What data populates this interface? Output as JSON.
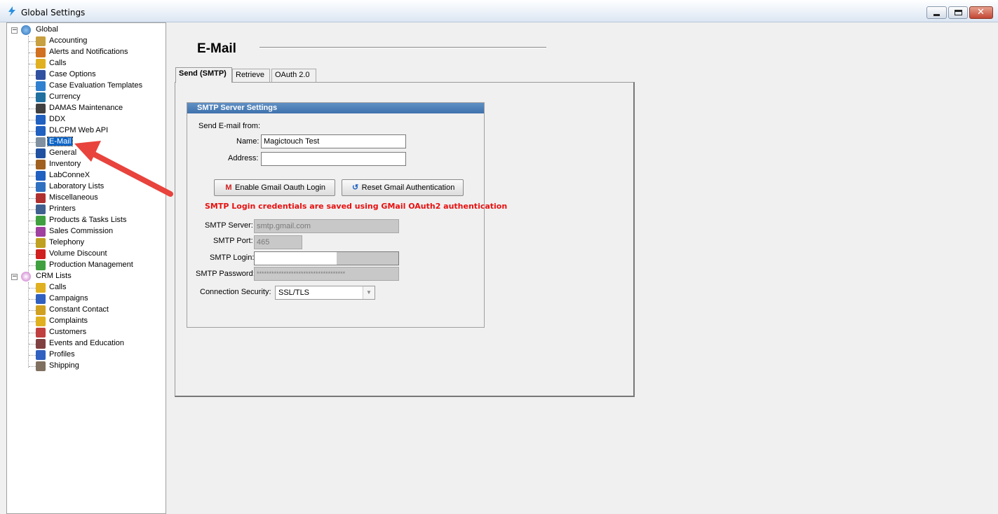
{
  "window": {
    "title": "Global Settings",
    "min_label": "▁",
    "max_label": "□",
    "close_label": "✕"
  },
  "tree": {
    "global": {
      "label": "Global",
      "items": [
        {
          "label": "Accounting",
          "icon": "accounting-icon",
          "color": "#c8a040"
        },
        {
          "label": "Alerts and Notifications",
          "icon": "alarm-clock-icon",
          "color": "#d07020"
        },
        {
          "label": "Calls",
          "icon": "calls-icon",
          "color": "#e0b020"
        },
        {
          "label": "Case Options",
          "icon": "case-options-icon",
          "color": "#3050a0"
        },
        {
          "label": "Case Evaluation Templates",
          "icon": "star-icon",
          "color": "#3080d0"
        },
        {
          "label": "Currency",
          "icon": "currency-icon",
          "color": "#2070a0"
        },
        {
          "label": "DAMAS Maintenance",
          "icon": "wrench-icon",
          "color": "#404040"
        },
        {
          "label": "DDX",
          "icon": "pen-icon",
          "color": "#2060c0"
        },
        {
          "label": "DLCPM Web API",
          "icon": "pen-icon",
          "color": "#2060c0"
        },
        {
          "label": "E-Mail",
          "icon": "envelope-icon",
          "color": "#8090a0"
        },
        {
          "label": "General",
          "icon": "window-icon",
          "color": "#2050a0"
        },
        {
          "label": "Inventory",
          "icon": "inventory-icon",
          "color": "#a06020"
        },
        {
          "label": "LabConneX",
          "icon": "pen-icon",
          "color": "#2060c0"
        },
        {
          "label": "Laboratory Lists",
          "icon": "list-icon",
          "color": "#3070c0"
        },
        {
          "label": "Miscellaneous",
          "icon": "misc-icon",
          "color": "#b03030"
        },
        {
          "label": "Printers",
          "icon": "printer-icon",
          "color": "#406090"
        },
        {
          "label": "Products & Tasks Lists",
          "icon": "products-icon",
          "color": "#40a040"
        },
        {
          "label": "Sales Commission",
          "icon": "commission-icon",
          "color": "#a040a0"
        },
        {
          "label": "Telephony",
          "icon": "telephone-icon",
          "color": "#c0a020"
        },
        {
          "label": "Volume Discount",
          "icon": "percent-icon",
          "color": "#d02020"
        },
        {
          "label": "Production Management",
          "icon": "gear-icon",
          "color": "#40a040"
        }
      ]
    },
    "crm": {
      "label": "CRM Lists",
      "items": [
        {
          "label": "Calls",
          "icon": "calls-icon",
          "color": "#e0b020"
        },
        {
          "label": "Campaigns",
          "icon": "campaigns-icon",
          "color": "#3060c0"
        },
        {
          "label": "Constant Contact",
          "icon": "envelope-icon",
          "color": "#d0a020"
        },
        {
          "label": "Complaints",
          "icon": "complaints-icon",
          "color": "#e0b020"
        },
        {
          "label": "Customers",
          "icon": "person-icon",
          "color": "#c04040"
        },
        {
          "label": "Events and Education",
          "icon": "events-icon",
          "color": "#804040"
        },
        {
          "label": "Profiles",
          "icon": "profiles-icon",
          "color": "#3060c0"
        },
        {
          "label": "Shipping",
          "icon": "shipping-icon",
          "color": "#807060"
        }
      ]
    },
    "selected": "E-Mail"
  },
  "page": {
    "title": "E-Mail"
  },
  "tabs": [
    {
      "label": "Send (SMTP)",
      "active": true
    },
    {
      "label": "Retrieve",
      "active": false
    },
    {
      "label": "OAuth 2.0",
      "active": false
    }
  ],
  "smtp": {
    "group_title": "SMTP Server Settings",
    "send_from_label": "Send E-mail from:",
    "name_label": "Name:",
    "name_value": "Magictouch Test",
    "address_label": "Address:",
    "address_value": "",
    "enable_gmail_button": "Enable Gmail Oauth Login",
    "reset_gmail_button": "Reset Gmail Authentication",
    "warning": "SMTP Login credentials are saved using GMail OAuth2 authentication",
    "server_label": "SMTP Server:",
    "server_value": "smtp.gmail.com",
    "port_label": "SMTP Port:",
    "port_value": "465",
    "login_label": "SMTP Login:",
    "login_value": "",
    "password_label": "SMTP Password:",
    "password_value": "************************************",
    "security_label": "Connection Security:",
    "security_value": "SSL/TLS"
  },
  "colors": {
    "accent": "#0a64c8",
    "warning": "#e81010",
    "annotation_arrow": "#e8433c"
  }
}
